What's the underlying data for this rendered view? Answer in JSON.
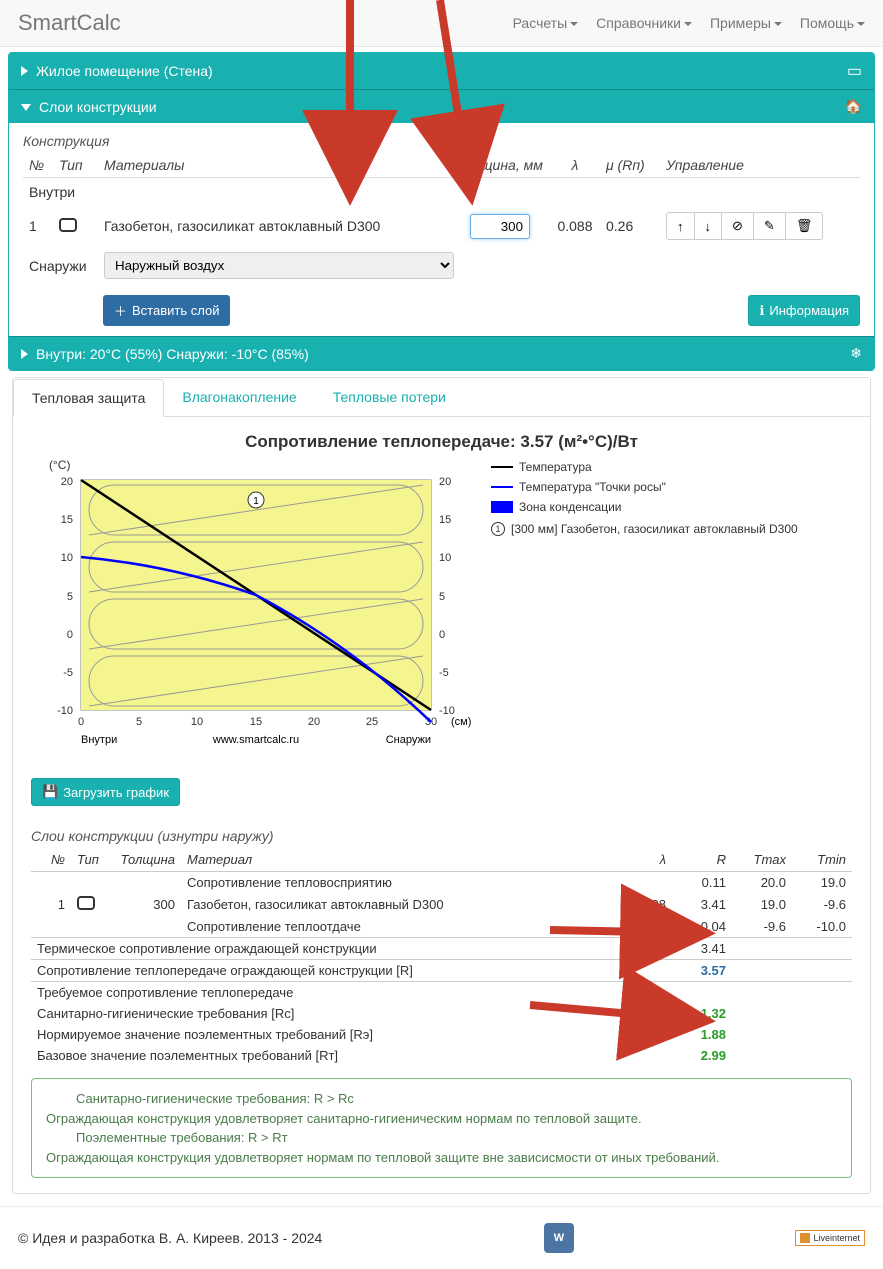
{
  "brand": "SmartCalc",
  "nav": {
    "calc": "Расчеты",
    "ref": "Справочники",
    "examples": "Примеры",
    "help": "Помощь"
  },
  "panels": {
    "room": "Жилое помещение (Стена)",
    "layers": "Слои конструкции",
    "conditions": "Внутри: 20°C (55%) Снаружи: -10°C (85%)"
  },
  "construction": {
    "title": "Конструкция",
    "headers": {
      "no": "№",
      "type": "Тип",
      "materials": "Материалы",
      "thickness": "Толщина, мм",
      "lambda": "λ",
      "mu": "μ (Rп)",
      "manage": "Управление"
    },
    "inside": "Внутри",
    "outside": "Снаружи",
    "outside_select": "Наружный воздух",
    "row": {
      "no": "1",
      "material": "Газобетон, газосиликат автоклавный D300",
      "thickness": "300",
      "lambda": "0.088",
      "mu": "0.26"
    },
    "insert": "Вставить слой",
    "info": "Информация"
  },
  "tabs": {
    "thermal": "Тепловая защита",
    "moisture": "Влагонакопление",
    "loss": "Тепловые потери"
  },
  "chart_data": {
    "type": "line",
    "title": "Сопротивление теплопередаче: 3.57 (м²•°С)/Вт",
    "xlabel": "(см)",
    "ylabel": "(°C)",
    "xlim": [
      0,
      30
    ],
    "ylim": [
      -10,
      20
    ],
    "xticks": [
      0,
      5,
      10,
      15,
      20,
      25,
      30
    ],
    "yticks": [
      -10,
      -5,
      0,
      5,
      10,
      15,
      20
    ],
    "series": [
      {
        "name": "Температура",
        "color": "black",
        "x": [
          0,
          5,
          10,
          15,
          20,
          25,
          30
        ],
        "y": [
          20,
          14.5,
          9,
          4,
          -1,
          -6,
          -10
        ]
      },
      {
        "name": "Температура \"Точки росы\"",
        "color": "blue",
        "x": [
          0,
          5,
          10,
          15,
          20,
          25,
          30
        ],
        "y": [
          10.5,
          9.5,
          8,
          5,
          1,
          -5,
          -11.5
        ]
      }
    ],
    "legend_extra": "Зона конденсации",
    "layer_label": "[300 мм] Газобетон, газосиликат автоклавный D300",
    "inside_label": "Внутри",
    "outside_label": "Снаружи",
    "credit": "www.smartcalc.ru"
  },
  "download_chart": "Загрузить график",
  "layers_table": {
    "title": "Слои конструкции (изнутри наружу)",
    "headers": {
      "no": "№",
      "type": "Тип",
      "thickness": "Толщина",
      "material": "Материал",
      "lambda": "λ",
      "R": "R",
      "tmax": "Tmax",
      "tmin": "Tmin"
    },
    "rows": [
      {
        "no": "",
        "type": "",
        "thickness": "",
        "material": "Сопротивление тепловосприятию",
        "lambda": "",
        "R": "0.11",
        "tmax": "20.0",
        "tmin": "19.0"
      },
      {
        "no": "1",
        "type": "icon",
        "thickness": "300",
        "material": "Газобетон, газосиликат автоклавный D300",
        "lambda": "0.088",
        "R": "3.41",
        "tmax": "19.0",
        "tmin": "-9.6"
      },
      {
        "no": "",
        "type": "",
        "thickness": "",
        "material": "Сопротивление теплоотдаче",
        "lambda": "",
        "R": "0.04",
        "tmax": "-9.6",
        "tmin": "-10.0"
      }
    ],
    "therm_res": {
      "label": "Термическое сопротивление ограждающей конструкции",
      "value": "3.41"
    },
    "transfer_res": {
      "label": "Сопротивление теплопередаче ограждающей конструкции [R]",
      "value": "3.57"
    },
    "required": "Требуемое сопротивление теплопередаче",
    "rc": {
      "label": "Санитарно-гигиенические требования [Rс]",
      "value": "1.32"
    },
    "re": {
      "label": "Нормируемое значение поэлементных требований [Rэ]",
      "value": "1.88"
    },
    "rt": {
      "label": "Базовое значение поэлементных требований [Rт]",
      "value": "2.99"
    }
  },
  "alert": {
    "line1_label": "Санитарно-гигиенические требования: R > Rс",
    "line1_text": "Ограждающая конструкция удовлетворяет санитарно-гигиеническим нормам по тепловой защите.",
    "line2_label": "Поэлементные требования: R > Rт",
    "line2_text": "Ограждающая конструкция удовлетворяет нормам по тепловой защите вне зависисмости от иных требований."
  },
  "footer": {
    "copyright": "© Идея и разработка В. А. Киреев. 2013 - 2024",
    "li": "Liveinternet"
  }
}
